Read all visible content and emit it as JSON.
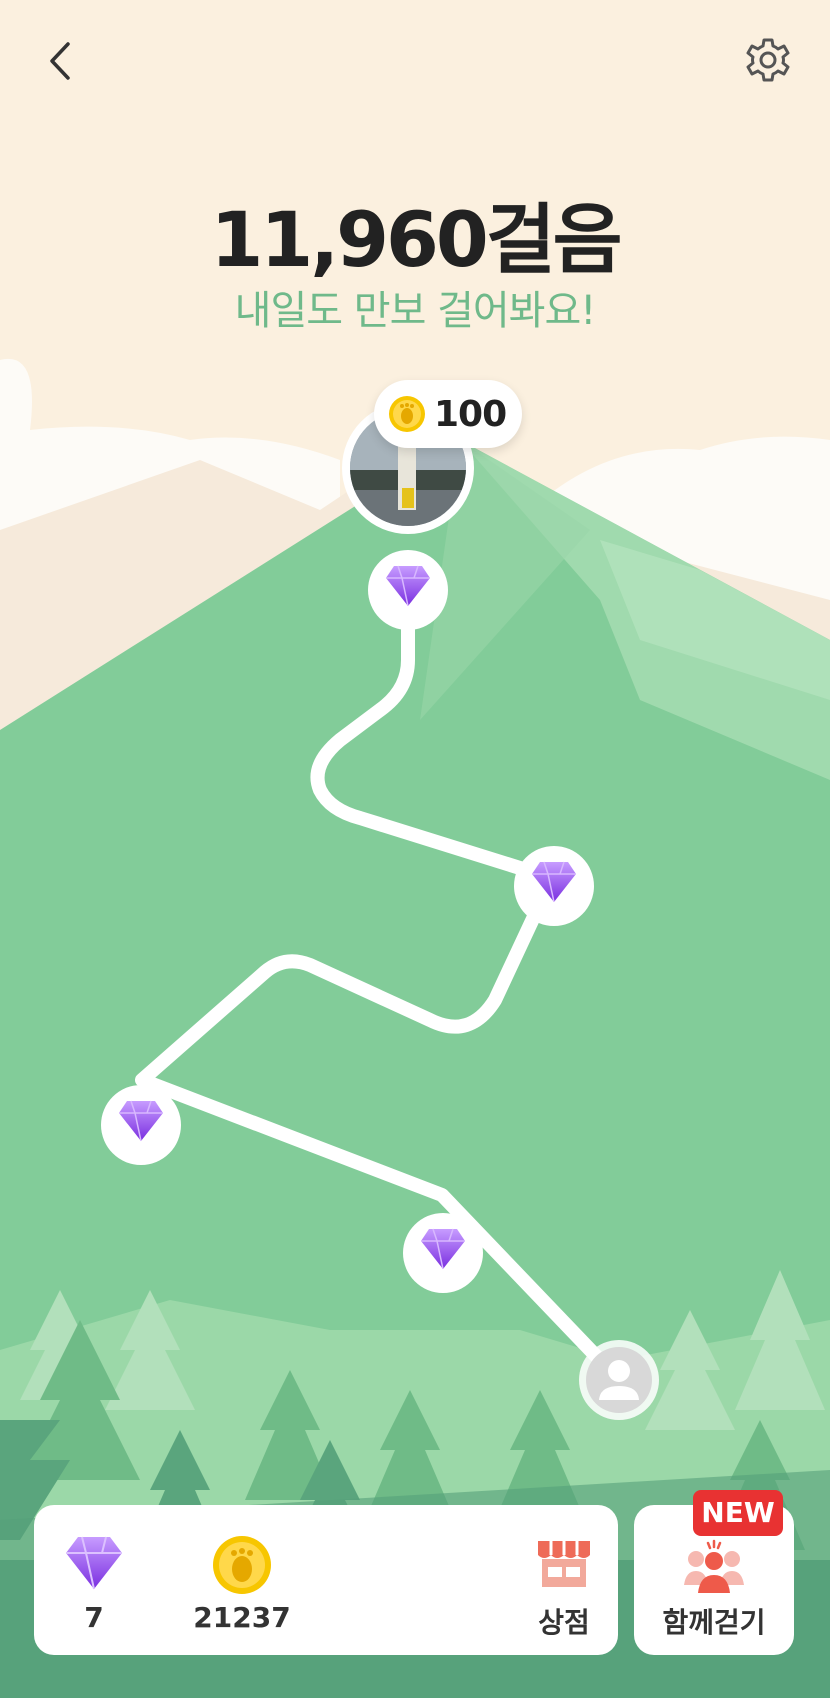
{
  "header": {
    "back_icon": "chevron-left-icon",
    "settings_icon": "gear-icon"
  },
  "summary": {
    "steps_text": "11,960걸음",
    "message": "내일도 만보 걸어봐요!"
  },
  "path": {
    "top_reward": {
      "icon": "coin-footprint-icon",
      "amount": "100"
    },
    "milestone_icon": "diamond-icon",
    "milestones_count": 4,
    "current_position_icon": "user-avatar-icon"
  },
  "bottom_bar": {
    "diamonds": {
      "icon": "diamond-icon",
      "value": "7"
    },
    "coins": {
      "icon": "coin-footprint-icon",
      "value": "21237"
    },
    "shop": {
      "icon": "store-icon",
      "label": "상점"
    },
    "walk_together": {
      "icon": "group-icon",
      "label": "함께걷기",
      "badge": "NEW"
    }
  },
  "colors": {
    "sky": "#fbf0df",
    "mountain": "#82cc99",
    "title_accent": "#6fb98a",
    "diamond": "#8d4be6",
    "badge": "#e83232"
  }
}
